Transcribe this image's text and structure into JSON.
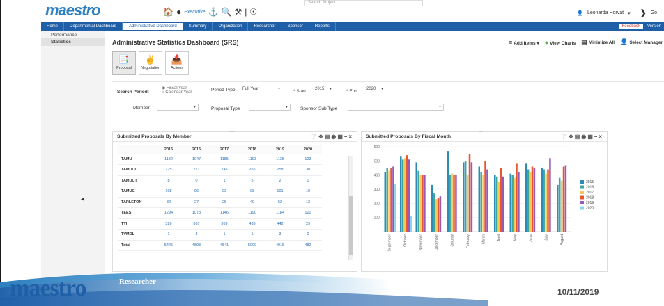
{
  "app": {
    "logo_text": "maestro",
    "exec_label": "Executive",
    "search_text": "Search Project",
    "user_name": "Leonarda Horvat",
    "go_label": "Go"
  },
  "nav": {
    "items": [
      "Home",
      "Departmental Dashboard",
      "Administrative Dashboard",
      "Summary",
      "Organization",
      "Researcher",
      "Sponsor",
      "Reports"
    ],
    "feedback_label": "Feedback",
    "version_label": "Version"
  },
  "sidebar": {
    "items": [
      "Performance",
      "Statistics"
    ]
  },
  "page": {
    "title": "Administrative Statistics Dashboard (SRS)"
  },
  "toolbar": {
    "add_items": "Add Items",
    "view_charts": "View Charts",
    "minimize_all": "Minimize All",
    "select_manager": "Select Manager"
  },
  "tiles": [
    "Proposal",
    "Negotiation",
    "Actions"
  ],
  "search": {
    "period_label": "Search Period:",
    "radio_fiscal": "Fiscal Year",
    "radio_calendar": "Calendar Year",
    "period_type_label": "Period Type",
    "period_type_value": "Full Year",
    "start_label": "* Start",
    "start_value": "2015",
    "end_label": "* End",
    "end_value": "2020",
    "member_label": "Member",
    "proposal_type_label": "Proposal Type",
    "sponsor_sub_type_label": "Sponsor Sub Type"
  },
  "member_table": {
    "title": "Submitted Proposals By Member",
    "columns": [
      "",
      "2015",
      "2016",
      "2017",
      "2018",
      "2019",
      "2020"
    ],
    "rows": [
      [
        "TAMU",
        "1182",
        "1047",
        "1185",
        "1193",
        "1135",
        "123"
      ],
      [
        "TAMUCC",
        "225",
        "217",
        "245",
        "265",
        "258",
        "30"
      ],
      [
        "TAMUCT",
        "8",
        "0",
        "1",
        "5",
        "2",
        "0"
      ],
      [
        "TAMUG",
        "108",
        "96",
        "93",
        "98",
        "101",
        "10"
      ],
      [
        "TARLETON",
        "32",
        "27",
        "25",
        "49",
        "52",
        "13"
      ],
      [
        "TEES",
        "1294",
        "1073",
        "1146",
        "1190",
        "1184",
        "120"
      ],
      [
        "TTI",
        "326",
        "367",
        "369",
        "433",
        "442",
        "29"
      ],
      [
        "TVMDL",
        "1",
        "3",
        "1",
        "1",
        "3",
        "0"
      ],
      [
        "Total",
        "5446",
        "4893",
        "4841",
        "5009",
        "4915",
        "482"
      ]
    ]
  },
  "chart_data": {
    "type": "bar",
    "title": "Submitted Proposals By Fiscal Month",
    "categories": [
      "September",
      "October",
      "November",
      "December",
      "January",
      "February",
      "March",
      "April",
      "May",
      "June",
      "July",
      "August"
    ],
    "series": [
      {
        "name": "2015",
        "values": [
          420,
          530,
          490,
          330,
          570,
          490,
          460,
          400,
          410,
          480,
          450,
          330
        ]
      },
      {
        "name": "2016",
        "values": [
          450,
          510,
          430,
          270,
          400,
          500,
          420,
          390,
          400,
          440,
          440,
          380
        ]
      },
      {
        "name": "2017",
        "values": [
          430,
          520,
          400,
          230,
          410,
          400,
          400,
          350,
          380,
          420,
          410,
          360
        ]
      },
      {
        "name": "2018",
        "values": [
          450,
          540,
          400,
          240,
          400,
          550,
          500,
          450,
          480,
          460,
          440,
          460
        ]
      },
      {
        "name": "2019",
        "values": [
          460,
          510,
          400,
          250,
          400,
          490,
          440,
          390,
          420,
          450,
          520,
          470
        ]
      },
      {
        "name": "2020",
        "values": [
          340,
          110,
          0,
          0,
          0,
          0,
          0,
          0,
          0,
          0,
          0,
          0
        ]
      }
    ],
    "ylim": [
      0,
      600
    ],
    "yticks": [
      100,
      200,
      300,
      400,
      500,
      600
    ],
    "colors": [
      "#2b8cb8",
      "#3fa79a",
      "#f5c85a",
      "#e8562f",
      "#9b59b6",
      "#8fd3e8"
    ],
    "grid": true,
    "legend_position": "right"
  },
  "footer": {
    "logo_text": "maestro",
    "sub_label": "Researcher",
    "date": "10/11/2019"
  }
}
